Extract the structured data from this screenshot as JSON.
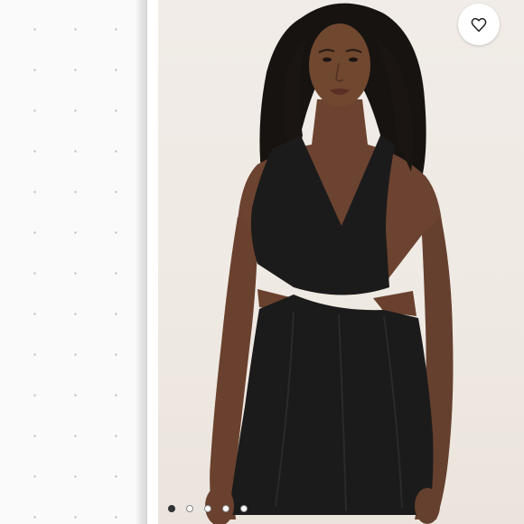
{
  "product_image": {
    "alt": "",
    "background_color": "#efe9e3",
    "garment_color": "#1c1b1b"
  },
  "like_button": {
    "icon": "heart-outline-icon"
  },
  "carousel": {
    "dot_count": 5,
    "active_index": 0
  }
}
